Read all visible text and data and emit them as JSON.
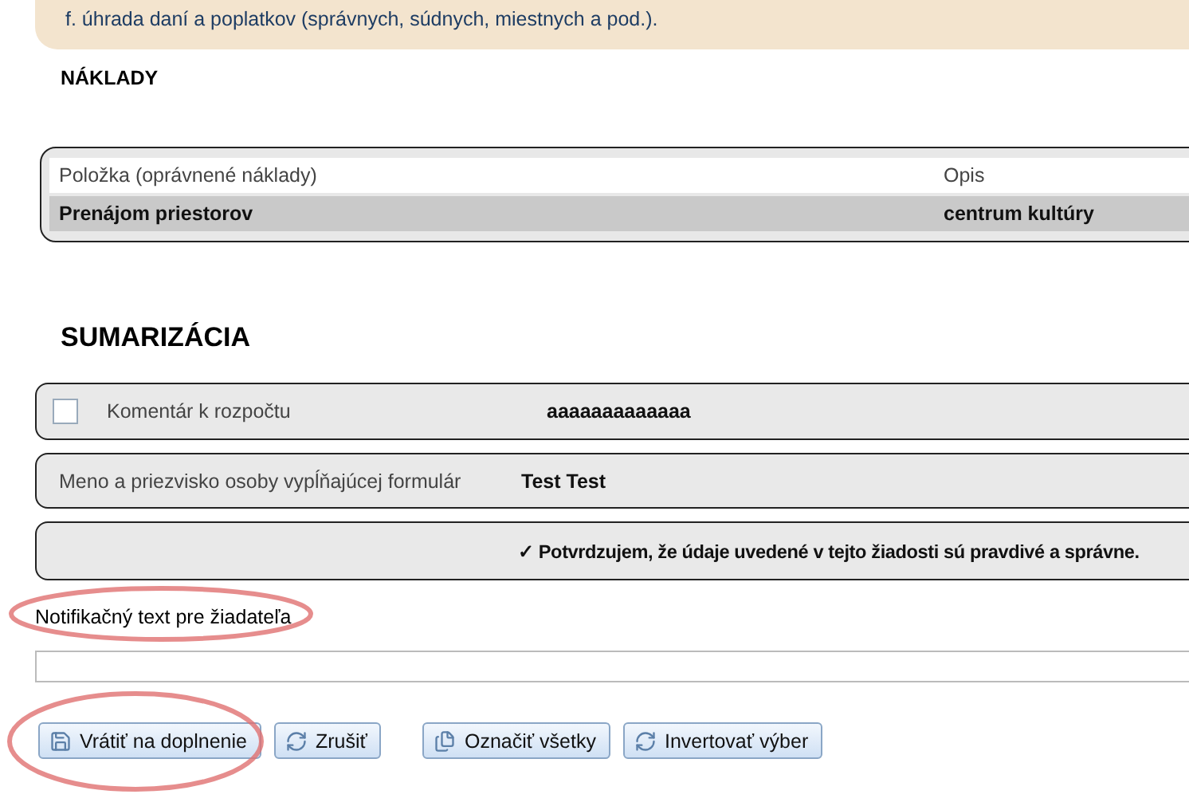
{
  "notice": {
    "lines": [
      "f. úhrada daní a poplatkov (správnych, súdnych, miestnych a pod.)."
    ]
  },
  "costs": {
    "title": "NÁKLADY",
    "columns": [
      "Položka (oprávnené náklady)",
      "Opis"
    ],
    "rows": [
      [
        "Prenájom priestorov",
        "centrum kultúry"
      ]
    ]
  },
  "summary": {
    "title": "SUMARIZÁCIA",
    "rows": [
      {
        "kind": "checkbox",
        "checked": false,
        "label": "Komentár k rozpočtu",
        "value": "aaaaaaaaaaaaa"
      },
      {
        "kind": "field",
        "label": "Meno a priezvisko osoby vypĺňajúcej formulár",
        "value": "Test Test"
      },
      {
        "kind": "confirm",
        "mark": "✓",
        "value": "Potvrdzujem, že údaje uvedené v tejto žiadosti sú pravdivé a správne."
      }
    ]
  },
  "notification": {
    "label": "Notifikačný text pre žiadateľa",
    "highlighted": true
  },
  "buttons": [
    {
      "label": "Vrátiť na doplnenie",
      "kind": "save",
      "highlighted": true
    },
    {
      "label": "Zrušiť",
      "kind": "undo",
      "highlighted": false
    },
    {
      "label": "Označiť všetky",
      "kind": "select",
      "highlighted": false
    },
    {
      "label": "Invertovať výber",
      "kind": "invert",
      "highlighted": false
    }
  ]
}
